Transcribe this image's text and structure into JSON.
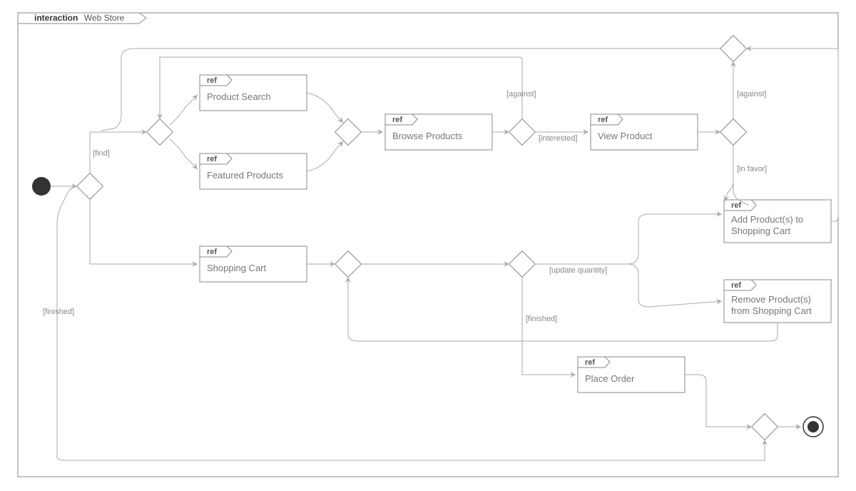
{
  "frame": {
    "keyword": "interaction",
    "name": "Web Store"
  },
  "refs": {
    "ref_label": "ref",
    "product_search": "Product Search",
    "featured_products": "Featured Products",
    "browse_products": "Browse Products",
    "view_product": "View Product",
    "add_to_cart_l1": "Add Product(s) to",
    "add_to_cart_l2": "Shopping Cart",
    "remove_from_cart_l1": "Remove Product(s)",
    "remove_from_cart_l2": "from Shopping Cart",
    "shopping_cart": "Shopping Cart",
    "place_order": "Place Order"
  },
  "guards": {
    "find": "[find]",
    "against": "[against]",
    "interested": "[interested]",
    "in_favor": "[in favor]",
    "update_quantity": "[update quantity]",
    "finished": "[finished]",
    "finished_left": "[finished]"
  }
}
